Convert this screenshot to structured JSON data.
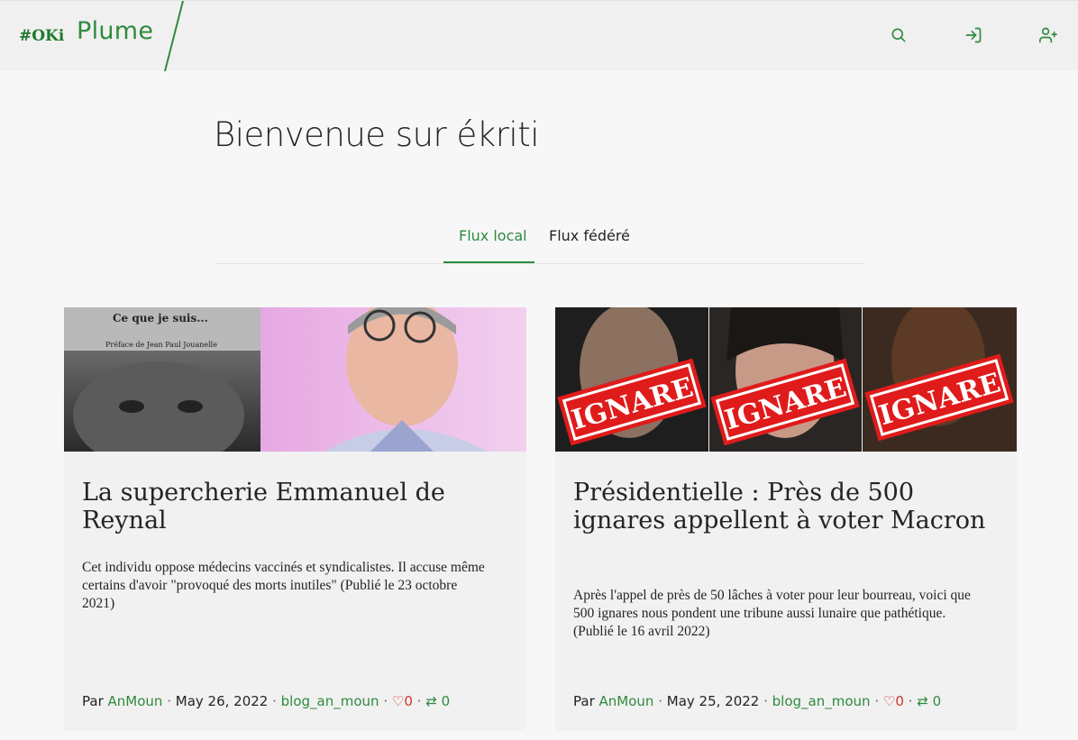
{
  "header": {
    "logo_text": "#OKi",
    "app_name": "Plume",
    "icons": [
      "search-icon",
      "log-in-icon",
      "user-plus-icon"
    ]
  },
  "page": {
    "title": "Bienvenue sur ékriti"
  },
  "tabs": [
    {
      "label": "Flux local",
      "active": true
    },
    {
      "label": "Flux fédéré",
      "active": false
    }
  ],
  "cover_texts": {
    "book_title": "Ce que je suis...",
    "book_preface": "Préface de Jean Paul Jouanelle",
    "stamp": "IGNARE"
  },
  "articles": [
    {
      "title": "La supercherie Emmanuel de Reynal",
      "excerpt": "Cet individu oppose médecins vaccinés et syndicalistes. Il accuse même certains d'avoir \"provoqué des morts inutiles\" (Publié le 23 octobre 2021)",
      "by": "Par",
      "author": "AnMoun",
      "date": "May 26, 2022",
      "blog": "blog_an_moun",
      "likes": "0",
      "reshares": "0"
    },
    {
      "title": "Présidentielle : Près de 500 ignares appellent à voter Macron",
      "excerpt": "Après l'appel de près de 50 lâches à voter pour leur bourreau, voici que 500 ignares nous pondent une tribune aussi lunaire que pathétique. (Publié le 16 avril 2022)",
      "by": "Par",
      "author": "AnMoun",
      "date": "May 25, 2022",
      "blog": "blog_an_moun",
      "likes": "0",
      "reshares": "0"
    }
  ],
  "colors": {
    "accent": "#2f8a3f",
    "like": "#d0342c",
    "header_bg": "#f0f0f0",
    "card_bg": "#f1f1f1"
  }
}
